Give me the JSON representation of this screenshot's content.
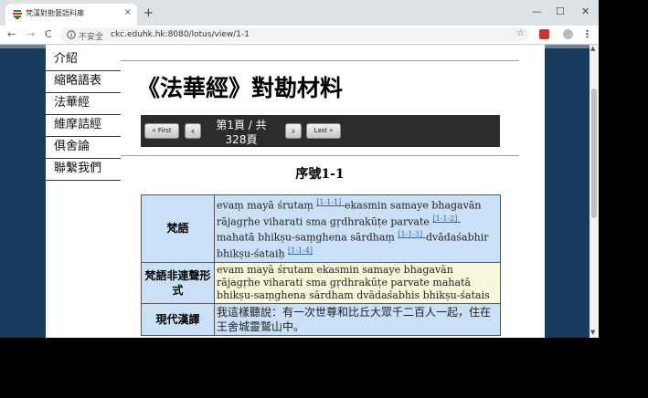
{
  "browser": {
    "tab_title": "梵漢對勘藝語料庫",
    "tab_close": "×",
    "new_tab": "+",
    "window_controls": [
      "—",
      "☐",
      "✕"
    ],
    "nav": {
      "back": "←",
      "forward": "→",
      "reload": "C"
    },
    "address": {
      "security": "不安全",
      "url": "ckc.eduhk.hk:8080/lotus/view/1-1"
    }
  },
  "sidebar": {
    "items": [
      {
        "label": "介紹"
      },
      {
        "label": "縮略語表"
      },
      {
        "label": "法華經"
      },
      {
        "label": "維摩詰經"
      },
      {
        "label": "俱舍論"
      },
      {
        "label": "聯繫我們"
      }
    ]
  },
  "main": {
    "title": "《法華經》對勘材料",
    "pager": {
      "first": "« First",
      "prev": "‹",
      "page_text": "第1頁 / 共328頁",
      "next": "›",
      "last": "Last »"
    },
    "serial": "序號1-1",
    "table": {
      "rows": [
        {
          "label": "梵語",
          "color": "#c9e0f6"
        },
        {
          "label": "梵語非連聲形式",
          "color": "#f7f7dc",
          "text": "evam mayā śrutam ekasmin samaye bhagavān rājagṛhe viharati sma gṛdhrakūṭe parvate mahatā bhikṣu-saṃghena sārdham dvādaśabhis bhikṣu-śatais"
        },
        {
          "label": "現代漢譯",
          "color": "#c9e0f6",
          "text": "我這樣聽說：有一次世尊和比丘大眾千二百人一起，住在王舍城靈鷲山中。"
        }
      ],
      "sanskrit_segments": [
        "evaṃ mayā śrutaṃ ",
        "-ekasmin samaye bhagavān rājagṛhe viharati sma gṛdhrakūṭe parvate ",
        "-mahatā bhikṣu-saṃghena sārdhaṃ ",
        "-dvādaśabhir bhikṣu-śataiḥ "
      ],
      "footnotes": [
        "[1-1-1]",
        "[1-1-2]",
        "[1-1-3]",
        "[1-1-4]"
      ]
    }
  }
}
